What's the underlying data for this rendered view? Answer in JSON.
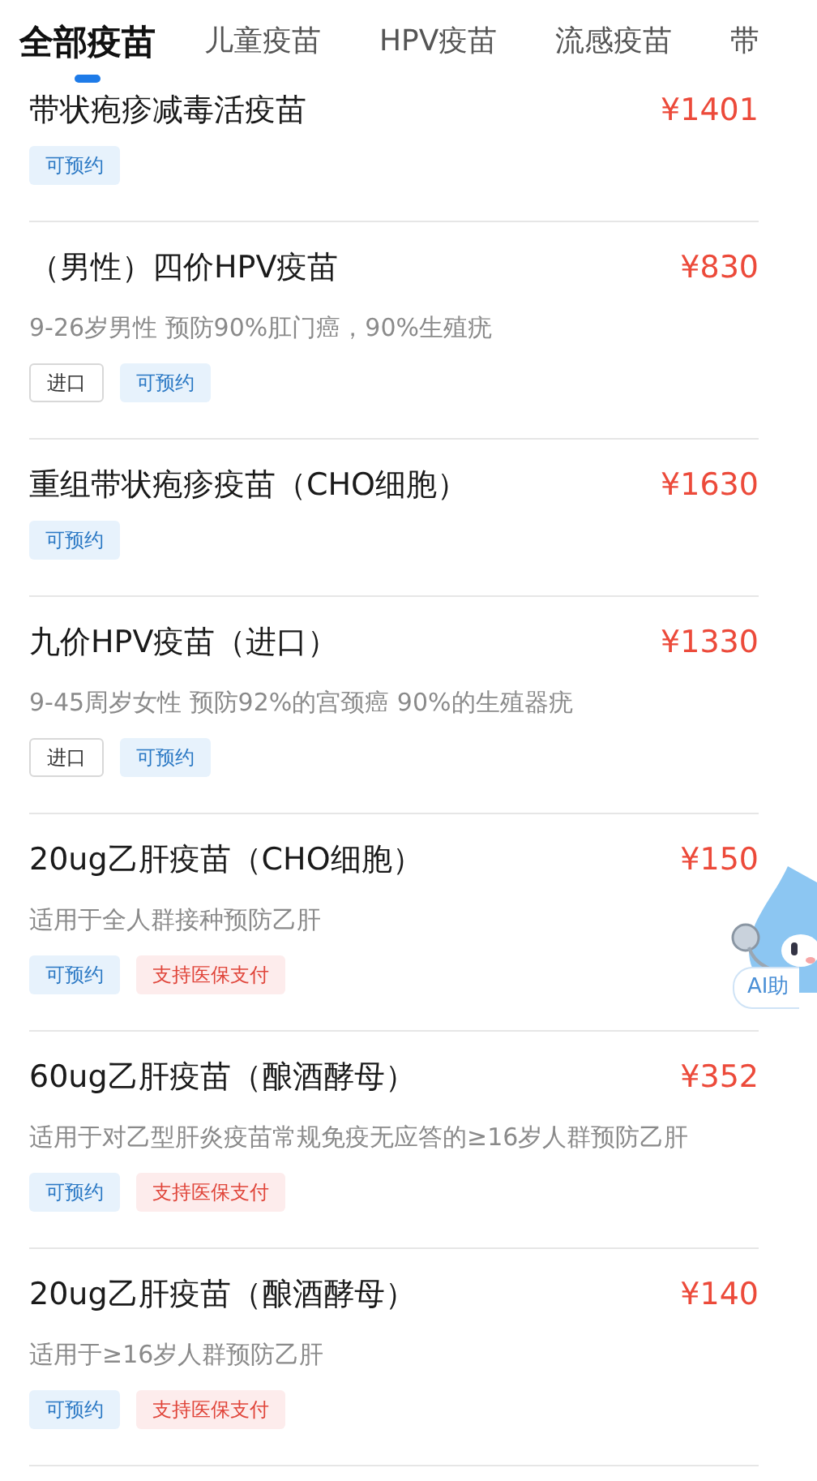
{
  "tabs": [
    {
      "label": "全部疫苗",
      "selected": true
    },
    {
      "label": "儿童疫苗",
      "selected": false
    },
    {
      "label": "HPV疫苗",
      "selected": false
    },
    {
      "label": "流感疫苗",
      "selected": false
    },
    {
      "label": "带",
      "selected": false
    }
  ],
  "vaccines": [
    {
      "name": "带状疱疹减毒活疫苗",
      "price": "¥1401",
      "tags": [
        {
          "kind": "available",
          "label": "可预约"
        }
      ]
    },
    {
      "name": "（男性）四价HPV疫苗",
      "price": "¥830",
      "description": "9-26岁男性 预防90%肛门癌，90%生殖疣",
      "tags": [
        {
          "kind": "imported",
          "label": "进口"
        },
        {
          "kind": "available",
          "label": "可预约"
        }
      ]
    },
    {
      "name": "重组带状疱疹疫苗（CHO细胞）",
      "price": "¥1630",
      "tags": [
        {
          "kind": "available",
          "label": "可预约"
        }
      ]
    },
    {
      "name": "九价HPV疫苗（进口）",
      "price": "¥1330",
      "description": "9-45周岁女性 预防92%的宫颈癌 90%的生殖器疣",
      "tags": [
        {
          "kind": "imported",
          "label": "进口"
        },
        {
          "kind": "available",
          "label": "可预约"
        }
      ]
    },
    {
      "name": "20ug乙肝疫苗（CHO细胞）",
      "price": "¥150",
      "description": "适用于全人群接种预防乙肝",
      "tags": [
        {
          "kind": "available",
          "label": "可预约"
        },
        {
          "kind": "insurance",
          "label": "支持医保支付"
        }
      ]
    },
    {
      "name": "60ug乙肝疫苗（酿酒酵母）",
      "price": "¥352",
      "description": "适用于对乙型肝炎疫苗常规免疫无应答的≥16岁人群预防乙肝",
      "tags": [
        {
          "kind": "available",
          "label": "可预约"
        },
        {
          "kind": "insurance",
          "label": "支持医保支付"
        }
      ]
    },
    {
      "name": "20ug乙肝疫苗（酿酒酵母）",
      "price": "¥140",
      "description": "适用于≥16岁人群预防乙肝",
      "tags": [
        {
          "kind": "available",
          "label": "可预约"
        },
        {
          "kind": "insurance",
          "label": "支持医保支付"
        }
      ]
    }
  ],
  "assistant": {
    "label": "AI助"
  }
}
